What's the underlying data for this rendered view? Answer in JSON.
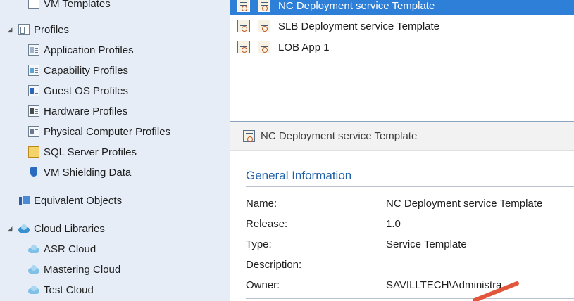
{
  "navigation_tree": {
    "items": [
      {
        "label": "VM Templates",
        "icon": "vm-templates-icon"
      },
      {
        "label": "Profiles",
        "icon": "profiles-icon",
        "expanded": true
      },
      {
        "label": "Application Profiles",
        "icon": "application-profile-icon"
      },
      {
        "label": "Capability Profiles",
        "icon": "capability-profile-icon"
      },
      {
        "label": "Guest OS Profiles",
        "icon": "guest-os-profile-icon"
      },
      {
        "label": "Hardware Profiles",
        "icon": "hardware-profile-icon"
      },
      {
        "label": "Physical Computer Profiles",
        "icon": "physical-computer-profile-icon"
      },
      {
        "label": "SQL Server Profiles",
        "icon": "sql-server-profile-icon"
      },
      {
        "label": "VM Shielding Data",
        "icon": "shield-icon"
      },
      {
        "label": "Equivalent Objects",
        "icon": "equivalent-objects-icon"
      },
      {
        "label": "Cloud Libraries",
        "icon": "cloud-libraries-icon",
        "expanded": true
      },
      {
        "label": "ASR Cloud",
        "icon": "cloud-icon"
      },
      {
        "label": "Mastering Cloud",
        "icon": "cloud-icon"
      },
      {
        "label": "Test Cloud",
        "icon": "cloud-icon"
      }
    ]
  },
  "template_list": {
    "rows": [
      {
        "name": "NC Deployment service Template",
        "selected": true
      },
      {
        "name": "SLB Deployment service Template",
        "selected": false
      },
      {
        "name": "LOB App 1",
        "selected": false
      }
    ]
  },
  "details": {
    "header": "NC Deployment service Template",
    "section_title": "General Information",
    "properties": [
      {
        "label": "Name:",
        "value": "NC Deployment service Template"
      },
      {
        "label": "Release:",
        "value": "1.0"
      },
      {
        "label": "Type:",
        "value": "Service Template"
      },
      {
        "label": "Description:",
        "value": ""
      },
      {
        "label": "Owner:",
        "value": "SAVILLTECH\\Administra"
      }
    ]
  },
  "colors": {
    "selection": "#2d7fd8",
    "tree_background": "#e6edf6",
    "section_title": "#1f5fa8",
    "annotation_arrow": "#e2573b"
  }
}
